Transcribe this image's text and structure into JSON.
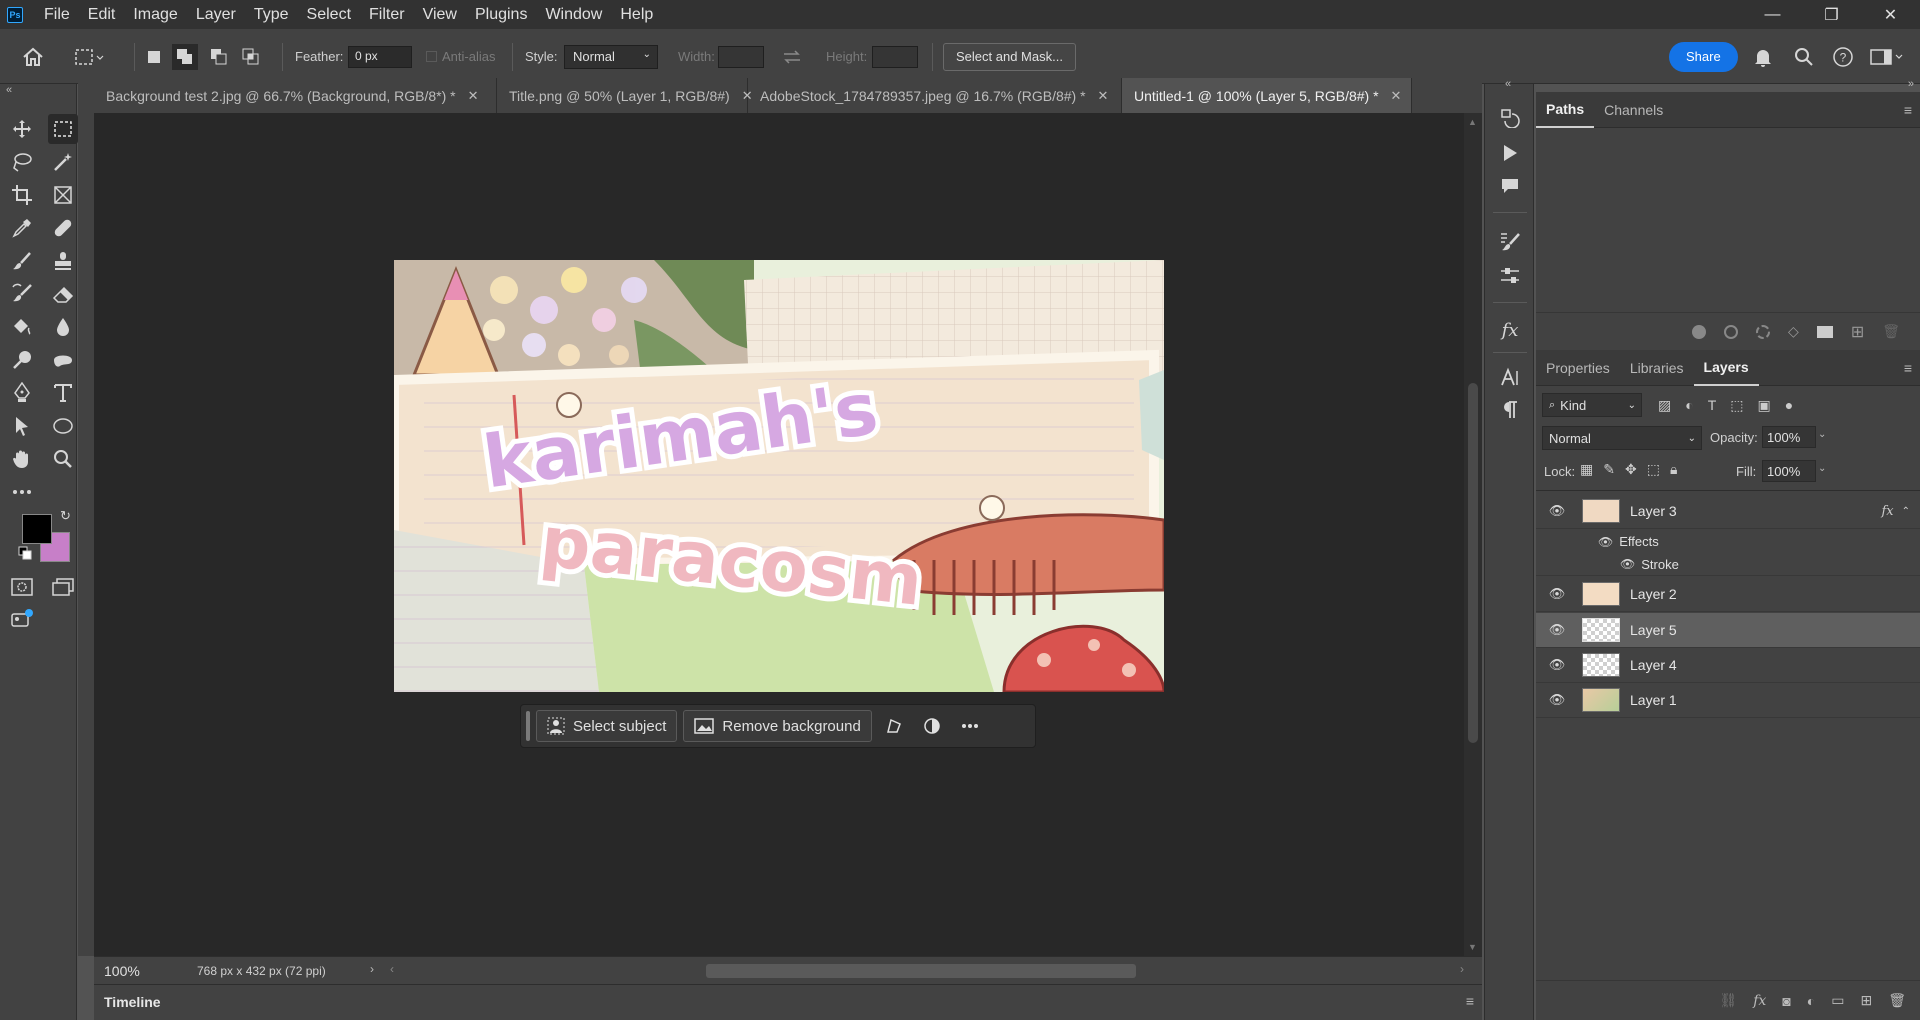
{
  "menu": {
    "items": [
      "File",
      "Edit",
      "Image",
      "Layer",
      "Type",
      "Select",
      "Filter",
      "View",
      "Plugins",
      "Window",
      "Help"
    ]
  },
  "window_controls": {
    "minimize": "—",
    "restore": "❐",
    "close": "✕"
  },
  "options": {
    "feather_label": "Feather:",
    "feather_value": "0 px",
    "antialias_label": "Anti-alias",
    "style_label": "Style:",
    "style_value": "Normal",
    "width_label": "Width:",
    "height_label": "Height:",
    "select_mask_label": "Select and Mask...",
    "share_label": "Share"
  },
  "tabs": [
    {
      "label": "Background test 2.jpg @ 66.7% (Background, RGB/8*) *"
    },
    {
      "label": "Title.png @ 50% (Layer 1, RGB/8#)"
    },
    {
      "label": "AdobeStock_1784789357.jpeg @ 16.7% (RGB/8#) *"
    },
    {
      "label": "Untitled-1 @ 100% (Layer 5, RGB/8#) *"
    }
  ],
  "taskbar": {
    "select_subject": "Select subject",
    "remove_background": "Remove background"
  },
  "status": {
    "zoom": "100%",
    "doc_info": "768 px x 432 px (72 ppi)"
  },
  "timeline": {
    "label": "Timeline"
  },
  "paths_panel": {
    "tabs": [
      "Paths",
      "Channels"
    ]
  },
  "layers_panel": {
    "tabs": [
      "Properties",
      "Libraries",
      "Layers"
    ],
    "filter_kind": "Kind",
    "blend_mode": "Normal",
    "opacity_label": "Opacity:",
    "opacity_value": "100%",
    "lock_label": "Lock:",
    "fill_label": "Fill:",
    "fill_value": "100%",
    "layers": [
      {
        "name": "Layer 3",
        "fx": "fx"
      },
      {
        "name": "Layer 2"
      },
      {
        "name": "Layer 5"
      },
      {
        "name": "Layer 4"
      },
      {
        "name": "Layer 1"
      }
    ],
    "effects_label": "Effects",
    "stroke_label": "Stroke"
  },
  "colors": {
    "foreground": "#000000",
    "background": "#c77fc8",
    "share_button": "#1473e6"
  }
}
